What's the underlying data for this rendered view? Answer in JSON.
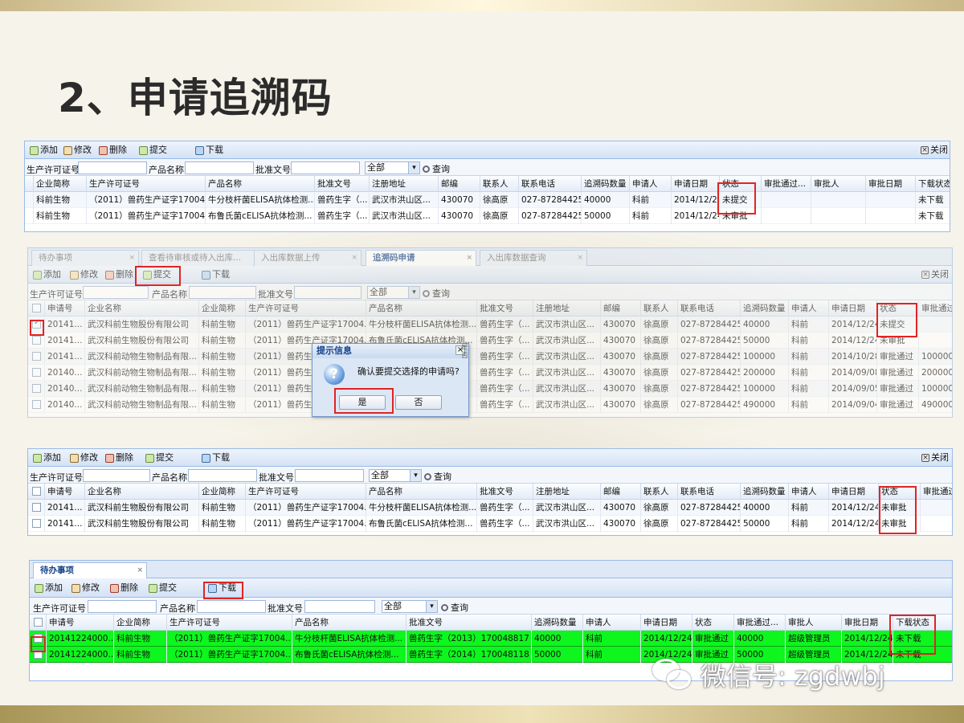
{
  "slide_title": "2、申请追溯码",
  "panel1": {
    "toolbar": {
      "add": "添加",
      "edit": "修改",
      "delete": "删除",
      "submit": "提交",
      "download": "下载",
      "close": "关闭"
    },
    "search": {
      "license_label": "生产许可证号",
      "product_label": "产品名称",
      "approval_label": "批准文号",
      "select_value": "全部",
      "query": "查询"
    },
    "columns": [
      "企业简称",
      "生产许可证号",
      "产品名称",
      "批准文号",
      "注册地址",
      "邮编",
      "联系人",
      "联系电话",
      "追溯码数量",
      "申请人",
      "申请日期",
      "状态",
      "审批通过...",
      "审批人",
      "审批日期",
      "下载状态"
    ],
    "rows": [
      [
        "科前生物",
        "（2011）兽药生产证字17004...",
        "牛分枝杆菌ELISA抗体检测...",
        "兽药生字（...",
        "武汉市洪山区...",
        "430070",
        "徐高原",
        "027-87284425",
        "40000",
        "科前",
        "2014/12/24",
        "未提交",
        "",
        "",
        "",
        "未下载"
      ],
      [
        "科前生物",
        "（2011）兽药生产证字17004...",
        "布鲁氏菌cELISA抗体检测...",
        "兽药生字（...",
        "武汉市洪山区...",
        "430070",
        "徐高原",
        "027-87284425",
        "50000",
        "科前",
        "2014/12/24",
        "未审批",
        "",
        "",
        "",
        "未下载"
      ]
    ]
  },
  "panel2": {
    "tabs": [
      "待办事项",
      "查看待审核或待入出库...",
      "入出库数据上传",
      "追溯码申请",
      "入出库数据查询"
    ],
    "toolbar": {
      "add": "添加",
      "edit": "修改",
      "delete": "删除",
      "submit": "提交",
      "download": "下载",
      "close": "关闭"
    },
    "search": {
      "license_label": "生产许可证号",
      "product_label": "产品名称",
      "approval_label": "批准文号",
      "select_value": "全部",
      "query": "查询"
    },
    "columns": [
      "申请号",
      "企业名称",
      "企业简称",
      "生产许可证号",
      "产品名称",
      "批准文号",
      "注册地址",
      "邮编",
      "联系人",
      "联系电话",
      "追溯码数量",
      "申请人",
      "申请日期",
      "状态",
      "审批通过"
    ],
    "rows": [
      [
        "20141...",
        "武汉科前生物股份有限公司",
        "科前生物",
        "（2011）兽药生产证字17004...",
        "牛分枝杆菌ELISA抗体检测...",
        "兽药生字（...",
        "武汉市洪山区...",
        "430070",
        "徐高原",
        "027-87284425",
        "40000",
        "科前",
        "2014/12/24",
        "未提交",
        ""
      ],
      [
        "20141...",
        "武汉科前生物股份有限公司",
        "科前生物",
        "（2011）兽药生产证字17004...",
        "布鲁氏菌cELISA抗体检测...",
        "兽药生字（...",
        "武汉市洪山区...",
        "430070",
        "徐高原",
        "027-87284425",
        "50000",
        "科前",
        "2014/12/24",
        "未审批",
        ""
      ],
      [
        "20141...",
        "武汉科前动物生物制品有限...",
        "科前生物",
        "（2011）兽药生产证字17004...",
        "",
        "兽药生字（...",
        "武汉市洪山区...",
        "430070",
        "徐高原",
        "027-87284425",
        "100000",
        "科前",
        "2014/10/28",
        "审批通过",
        "100000"
      ],
      [
        "20140...",
        "武汉科前动物生物制品有限...",
        "科前生物",
        "（2011）兽药生产证字17004...",
        "",
        "兽药生字（...",
        "武汉市洪山区...",
        "430070",
        "徐高原",
        "027-87284425",
        "200000",
        "科前",
        "2014/09/08",
        "审批通过",
        "200000"
      ],
      [
        "20140...",
        "武汉科前动物生物制品有限...",
        "科前生物",
        "（2011）兽药生产证字17004...",
        "",
        "兽药生字（...",
        "武汉市洪山区...",
        "430070",
        "徐高原",
        "027-87284425",
        "100000",
        "科前",
        "2014/09/05",
        "审批通过",
        "100000"
      ],
      [
        "20140...",
        "武汉科前动物生物制品有限...",
        "科前生物",
        "（2011）兽药生产证字17004...",
        "",
        "兽药生字（...",
        "武汉市洪山区...",
        "430070",
        "徐高原",
        "027-87284425",
        "490000",
        "科前",
        "2014/09/04",
        "审批通过",
        "490000"
      ]
    ],
    "dialog": {
      "title": "提示信息",
      "icon": "?",
      "message": "确认要提交选择的申请吗?",
      "yes": "是",
      "no": "否",
      "close": "×",
      "hint": "是否"
    }
  },
  "panel3": {
    "toolbar": {
      "add": "添加",
      "edit": "修改",
      "delete": "删除",
      "submit": "提交",
      "download": "下载",
      "close": "关闭"
    },
    "search": {
      "license_label": "生产许可证号",
      "product_label": "产品名称",
      "approval_label": "批准文号",
      "select_value": "全部",
      "query": "查询"
    },
    "columns": [
      "申请号",
      "企业名称",
      "企业简称",
      "生产许可证号",
      "产品名称",
      "批准文号",
      "注册地址",
      "邮编",
      "联系人",
      "联系电话",
      "追溯码数量",
      "申请人",
      "申请日期",
      "状态",
      "审批通过"
    ],
    "rows": [
      [
        "20141...",
        "武汉科前生物股份有限公司",
        "科前生物",
        "（2011）兽药生产证字17004...",
        "牛分枝杆菌ELISA抗体检测...",
        "兽药生字（...",
        "武汉市洪山区...",
        "430070",
        "徐高原",
        "027-87284425",
        "40000",
        "科前",
        "2014/12/24",
        "未审批",
        ""
      ],
      [
        "20141...",
        "武汉科前生物股份有限公司",
        "科前生物",
        "（2011）兽药生产证字17004...",
        "布鲁氏菌cELISA抗体检测...",
        "兽药生字（...",
        "武汉市洪山区...",
        "430070",
        "徐高原",
        "027-87284425",
        "50000",
        "科前",
        "2014/12/24",
        "未审批",
        ""
      ]
    ]
  },
  "panel4": {
    "tab": "待办事项",
    "toolbar": {
      "add": "添加",
      "edit": "修改",
      "delete": "删除",
      "submit": "提交",
      "download": "下载"
    },
    "search": {
      "license_label": "生产许可证号",
      "product_label": "产品名称",
      "approval_label": "批准文号",
      "select_value": "全部",
      "query": "查询"
    },
    "columns": [
      "申请号",
      "企业简称",
      "生产许可证号",
      "产品名称",
      "批准文号",
      "追溯码数量",
      "申请人",
      "申请日期",
      "状态",
      "审批通过...",
      "审批人",
      "审批日期",
      "下载状态"
    ],
    "rows": [
      [
        "20141224000...",
        "科前生物",
        "（2011）兽药生产证字17004...",
        "牛分枝杆菌ELISA抗体检测...",
        "兽药生字（2013）170048817",
        "40000",
        "科前",
        "2014/12/24",
        "审批通过",
        "40000",
        "超级管理员",
        "2014/12/24",
        "未下载"
      ],
      [
        "20141224000...",
        "科前生物",
        "（2011）兽药生产证字17004...",
        "布鲁氏菌cELISA抗体检测...",
        "兽药生字（2014）170048118",
        "50000",
        "科前",
        "2014/12/24",
        "审批通过",
        "50000",
        "超级管理员",
        "2014/12/24",
        "未下载"
      ]
    ]
  },
  "watermark": "微信号: zgdwbj"
}
